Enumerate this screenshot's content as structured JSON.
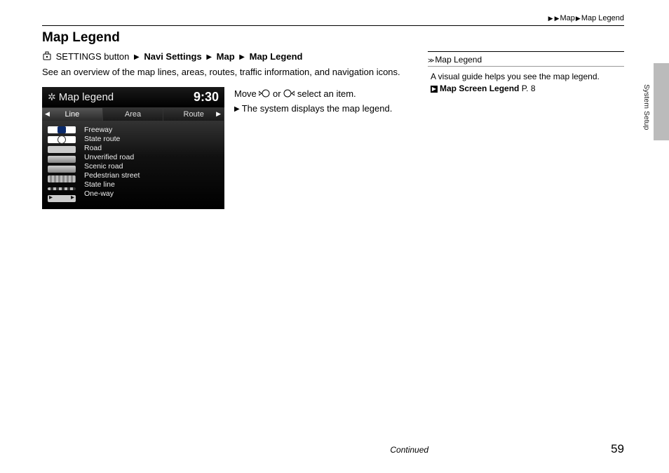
{
  "breadcrumb": {
    "seg1": "Map",
    "seg2": "Map Legend"
  },
  "heading": "Map Legend",
  "path": {
    "settings_label": "SETTINGS button",
    "step1": "Navi Settings",
    "step2": "Map",
    "step3": "Map Legend"
  },
  "description": "See an overview of the map lines, areas, routes, traffic information, and navigation icons.",
  "screenshot": {
    "title": "Map legend",
    "clock": "9:30",
    "tabs": {
      "line": "Line",
      "area": "Area",
      "route": "Route"
    },
    "items": {
      "freeway": "Freeway",
      "state_route": "State route",
      "road": "Road",
      "unverified": "Unverified road",
      "scenic": "Scenic road",
      "pedestrian": "Pedestrian street",
      "state_line": "State line",
      "one_way": "One-way"
    }
  },
  "instruction": {
    "move_prefix": "Move",
    "or": "or",
    "move_suffix": "select an item.",
    "result": "The system displays the map legend."
  },
  "sidebar": {
    "head": "Map Legend",
    "body": "A visual guide helps you see the map legend.",
    "link_label": "Map Screen Legend",
    "link_page_prefix": "P.",
    "link_page": "8"
  },
  "thumb": "System Setup",
  "footer": {
    "continued": "Continued",
    "page": "59"
  }
}
